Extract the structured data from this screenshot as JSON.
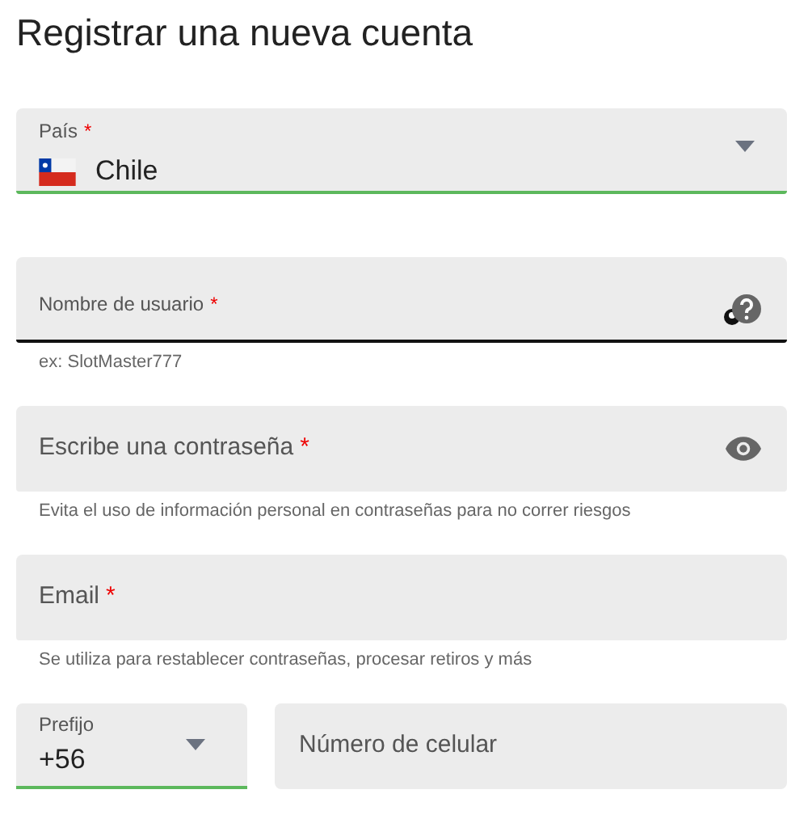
{
  "title": "Registrar una nueva cuenta",
  "fields": [
    {
      "kind": "select",
      "label": "País",
      "required_mark": "*",
      "value": "Chile",
      "flag": true,
      "valid": true
    },
    {
      "kind": "text",
      "label": "Nombre de usuario",
      "required_mark": "*",
      "focused": true,
      "help_button": true,
      "hint": "ex: SlotMaster777"
    },
    {
      "kind": "placeholder",
      "label": "Escribe una contraseña",
      "required_mark": "*",
      "visibility_toggle": true,
      "hint": "Evita el uso de información personal en contraseñas para no correr riesgos"
    },
    {
      "kind": "placeholder",
      "label": "Email",
      "required_mark": "*",
      "hint": "Se utiliza para restablecer contraseñas, procesar retiros y más"
    }
  ],
  "phone": {
    "prefix": {
      "label": "Prefijo",
      "value": "+56",
      "valid": true
    },
    "number": {
      "placeholder": "Número de celular"
    }
  }
}
